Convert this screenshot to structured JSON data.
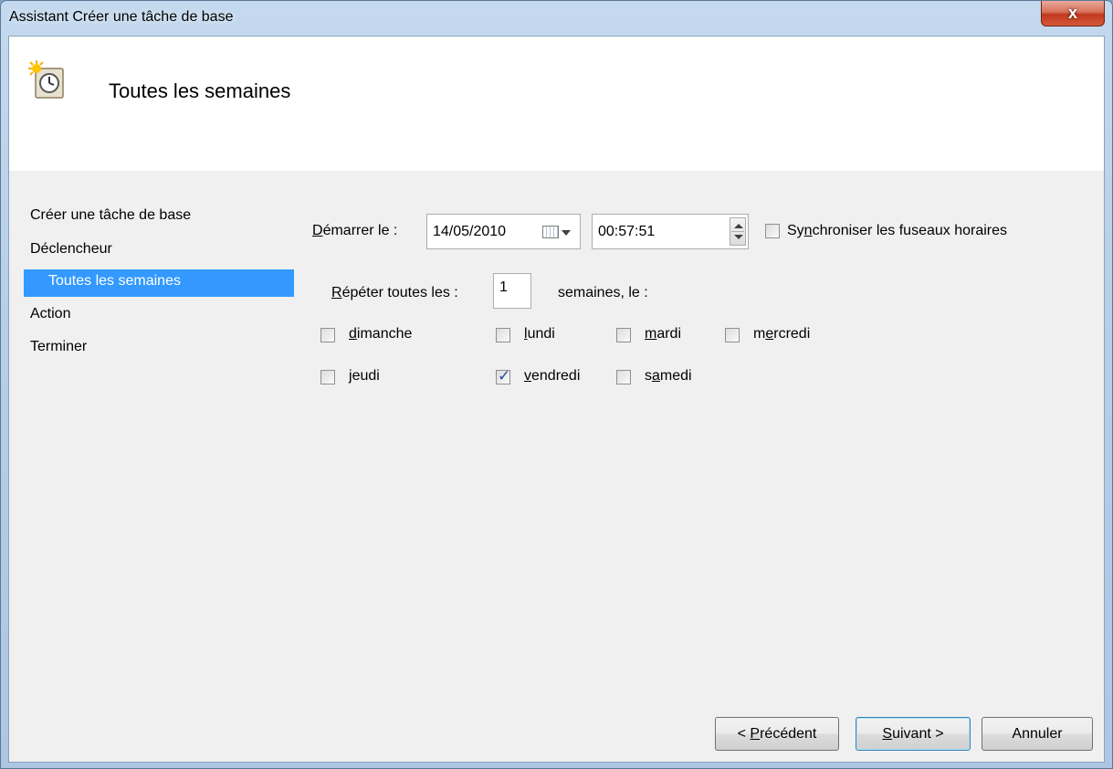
{
  "window": {
    "title": "Assistant Créer une tâche de base",
    "close_label": "x"
  },
  "header": {
    "title": "Toutes les semaines",
    "icon": "scheduled-task-clock-icon"
  },
  "nav": {
    "items": [
      {
        "label": "Créer une tâche de base"
      },
      {
        "label": "Déclencheur"
      },
      {
        "label": "Toutes les semaines",
        "selected": true
      },
      {
        "label": "Action"
      },
      {
        "label": "Terminer"
      }
    ],
    "selected_color": "#3399ff"
  },
  "trigger": {
    "start_label_pre": "D",
    "start_label_rest": "émarrer le :",
    "start_date": "14/05/2010",
    "start_time": "00:57:51",
    "sync_label_pre": "Sy",
    "sync_label_u": "n",
    "sync_label_rest": "chroniser les fuseaux horaires",
    "sync_checked": false,
    "repeat_label_u": "R",
    "repeat_label_rest": "épéter toutes les :",
    "repeat_value": "1",
    "repeat_suffix": "semaines, le :",
    "days": [
      {
        "pre": "",
        "u": "d",
        "rest": "imanche",
        "checked": false
      },
      {
        "pre": "",
        "u": "l",
        "rest": "undi",
        "checked": false
      },
      {
        "pre": "",
        "u": "m",
        "rest": "ardi",
        "checked": false
      },
      {
        "pre": "m",
        "u": "e",
        "rest": "rcredi",
        "checked": false
      },
      {
        "pre": "",
        "u": "j",
        "rest": "eudi",
        "checked": false
      },
      {
        "pre": "",
        "u": "v",
        "rest": "endredi",
        "checked": true
      },
      {
        "pre": "s",
        "u": "a",
        "rest": "medi",
        "checked": false
      }
    ]
  },
  "buttons": {
    "back_pre": "< ",
    "back_u": "P",
    "back_rest": "récédent",
    "next_u": "S",
    "next_rest": "uivant >",
    "cancel": "Annuler"
  }
}
